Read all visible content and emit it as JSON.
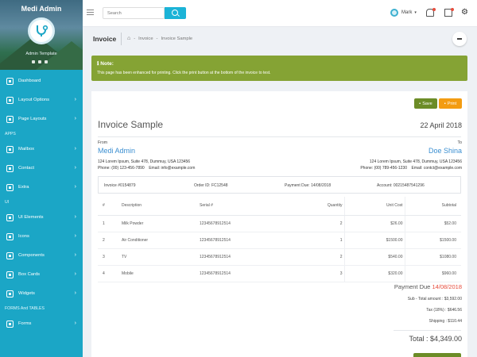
{
  "sidebar": {
    "brand": "Medi Admin",
    "subtitle": "Admin Template",
    "items": [
      {
        "label": "Dashboard",
        "icon": "dashboard-icon",
        "chevron": false
      },
      {
        "label": "Layout Options",
        "icon": "layout-icon",
        "chevron": true
      },
      {
        "label": "Page Layouts",
        "icon": "page-layouts-icon",
        "chevron": true
      },
      {
        "label": "Mailbox",
        "icon": "mailbox-icon",
        "chevron": true
      },
      {
        "label": "Contact",
        "icon": "contact-icon",
        "chevron": true
      },
      {
        "label": "Extra",
        "icon": "extra-icon",
        "chevron": true
      },
      {
        "label": "UI Elements",
        "icon": "ui-elements-icon",
        "chevron": true
      },
      {
        "label": "Icons",
        "icon": "icons-icon",
        "chevron": true
      },
      {
        "label": "Components",
        "icon": "components-icon",
        "chevron": true
      },
      {
        "label": "Box Cards",
        "icon": "box-cards-icon",
        "chevron": true
      },
      {
        "label": "Widgets",
        "icon": "widgets-icon",
        "chevron": true
      },
      {
        "label": "Forms",
        "icon": "forms-icon",
        "chevron": true
      }
    ],
    "sections": {
      "apps": "APPS",
      "ui": "UI",
      "forms": "FORMS And TABLES"
    }
  },
  "topbar": {
    "search_placeholder": "Search",
    "user_name": "Mark",
    "user_dropdown": "▾",
    "settings_glyph": "⚙"
  },
  "page": {
    "title": "Invoice",
    "breadcrumb": [
      "Invoice",
      "Invoice Sample"
    ],
    "home_glyph": "⌂",
    "crumb_sep": "-"
  },
  "note": {
    "title": "Note:",
    "icon_glyph": "ℹ",
    "text": "This page has been enhanced for printing. Click the print button at the bottom of the invoice to test."
  },
  "invoice": {
    "save_label": "Save",
    "print_label": "Print",
    "title": "Invoice Sample",
    "date": "22 April 2018",
    "from": {
      "label": "From",
      "name": "Medi Admin",
      "address": "124 Lorem Ipsum, Suite 478, Dummuy, USA 123456",
      "contact": "Phone: (00) 123-456-7890    Email: info@example.com"
    },
    "to": {
      "label": "To",
      "name": "Doe Shina",
      "address": "124 Lorem Ipsum, Suite 478, Dummuy, USA 123456",
      "contact": "Phone: (00) 789-456-1230    Email: contct@example.com"
    },
    "info": {
      "invoice_no": "Invoice #0154879",
      "order_id": "Order ID: FC12548",
      "payment_due": "Payment Due: 14/08/2018",
      "account": "Account: 00215487541296"
    },
    "columns": [
      "#",
      "Description",
      "Serial #",
      "Quantity",
      "Unit Cost",
      "Subtotal"
    ],
    "rows": [
      [
        "1",
        "Milk Powder",
        "12345678912514",
        "2",
        "$26.00",
        "$52.00"
      ],
      [
        "2",
        "Air Conditioner",
        "12345678912514",
        "1",
        "$1500.00",
        "$1500.00"
      ],
      [
        "3",
        "TV",
        "12345678912514",
        "2",
        "$540.00",
        "$1080.00"
      ],
      [
        "4",
        "Mobile",
        "12345678912514",
        "3",
        "$320.00",
        "$960.00"
      ]
    ],
    "payment_due_label": "Payment Due",
    "payment_due_date": "14/08/2018",
    "subtotal": "Sub - Total amount : $3,592.00",
    "tax": "Tax (18%) : $646.56",
    "shipping": "Shipping : $110.44",
    "total": "Total : $4,349.00"
  },
  "colors": {
    "sidebar": "#1ba6c6",
    "note": "#85a334",
    "link_blue": "#3b8fd1",
    "due_red": "#e74c3c",
    "print_orange": "#f39c12",
    "save_green": "#6c8c27"
  }
}
